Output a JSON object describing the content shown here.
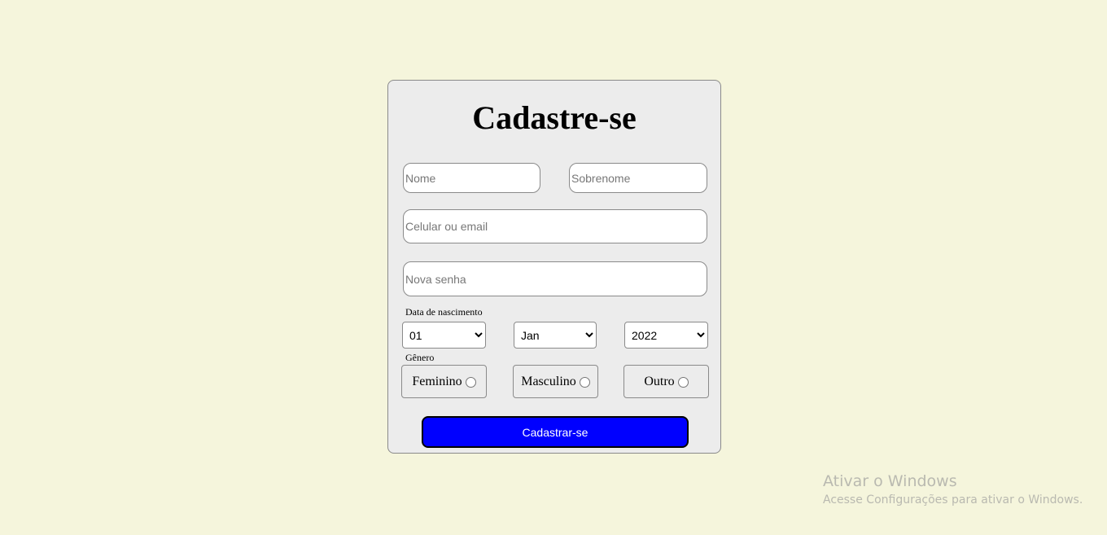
{
  "form": {
    "title": "Cadastre-se",
    "first_name_placeholder": "Nome",
    "last_name_placeholder": "Sobrenome",
    "contact_placeholder": "Celular ou email",
    "password_placeholder": "Nova senha",
    "birth_label": "Data de nascimento",
    "day_value": "01",
    "month_value": "Jan",
    "year_value": "2022",
    "gender_label": "Gênero",
    "gender_options": [
      "Feminino",
      "Masculino",
      "Outro"
    ],
    "submit_label": "Cadastrar-se"
  },
  "watermark": {
    "title": "Ativar o Windows",
    "subtitle": "Acesse Configurações para ativar o Windows."
  },
  "colors": {
    "background": "#f5f5dc",
    "card": "#ececec",
    "submit": "#0000ff"
  }
}
